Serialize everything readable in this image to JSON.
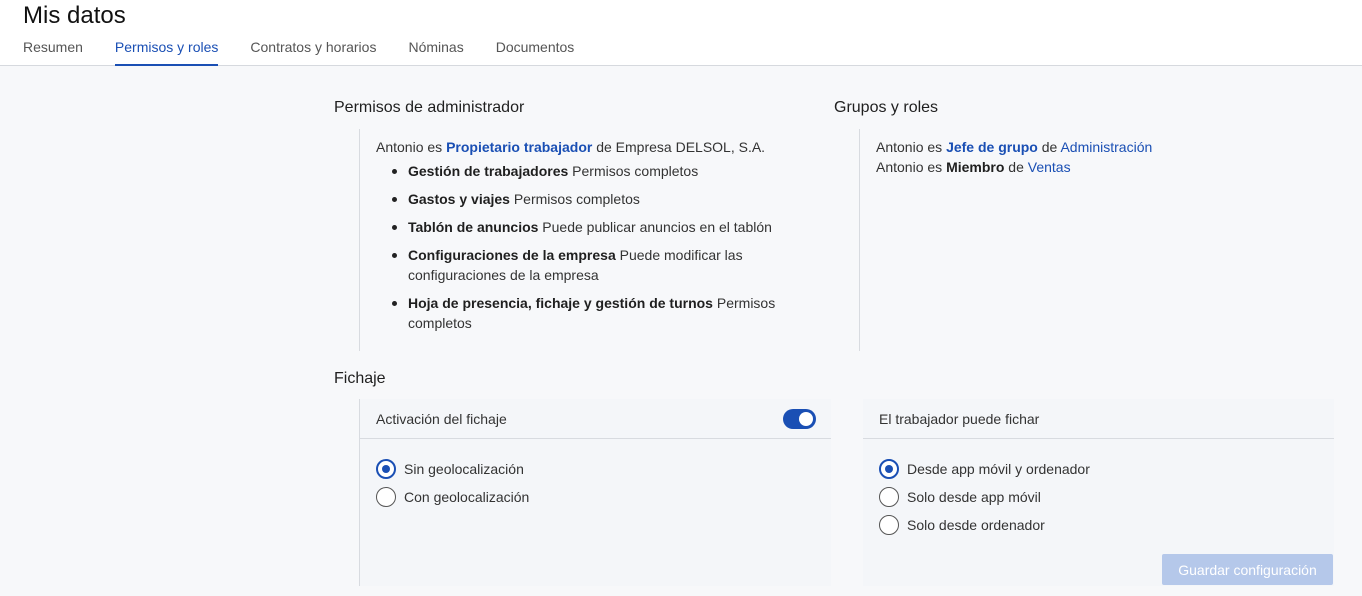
{
  "page": {
    "title": "Mis datos"
  },
  "tabs": [
    {
      "label": "Resumen"
    },
    {
      "label": "Permisos y roles"
    },
    {
      "label": "Contratos y horarios"
    },
    {
      "label": "Nóminas"
    },
    {
      "label": "Documentos"
    }
  ],
  "admin": {
    "title": "Permisos de administrador",
    "intro": {
      "subject": "Antonio es ",
      "role": "Propietario trabajador",
      "mid": " de Empresa DELSOL, S.A."
    },
    "items": [
      {
        "name": "Gestión de trabajadores",
        "desc": " Permisos completos"
      },
      {
        "name": "Gastos y viajes",
        "desc": " Permisos completos"
      },
      {
        "name": "Tablón de anuncios",
        "desc": " Puede publicar anuncios en el tablón"
      },
      {
        "name": "Configuraciones de la empresa",
        "desc": " Puede modificar las configuraciones de la empresa"
      },
      {
        "name": "Hoja de presencia, fichaje y gestión de turnos",
        "desc": " Permisos completos"
      }
    ]
  },
  "groups": {
    "title": "Grupos y roles",
    "line1": {
      "a": "Antonio es ",
      "role": "Jefe de grupo",
      "b": " de ",
      "group": "Administración"
    },
    "line2": {
      "a": "Antonio es ",
      "role": "Miembro",
      "b": " de ",
      "group": "Ventas"
    }
  },
  "fichaje": {
    "title": "Fichaje",
    "activation_label": "Activación del fichaje",
    "activation_on": true,
    "geo_options": [
      {
        "label": "Sin geolocalización",
        "checked": true
      },
      {
        "label": "Con geolocalización",
        "checked": false
      }
    ],
    "worker_label": "El trabajador puede fichar",
    "worker_options": [
      {
        "label": "Desde app móvil y ordenador",
        "checked": true
      },
      {
        "label": "Solo desde app móvil",
        "checked": false
      },
      {
        "label": "Solo desde ordenador",
        "checked": false
      }
    ],
    "save_label": "Guardar configuración"
  },
  "colors": {
    "accent": "#1a4fb4",
    "disabled_button": "#b5c8ea"
  }
}
